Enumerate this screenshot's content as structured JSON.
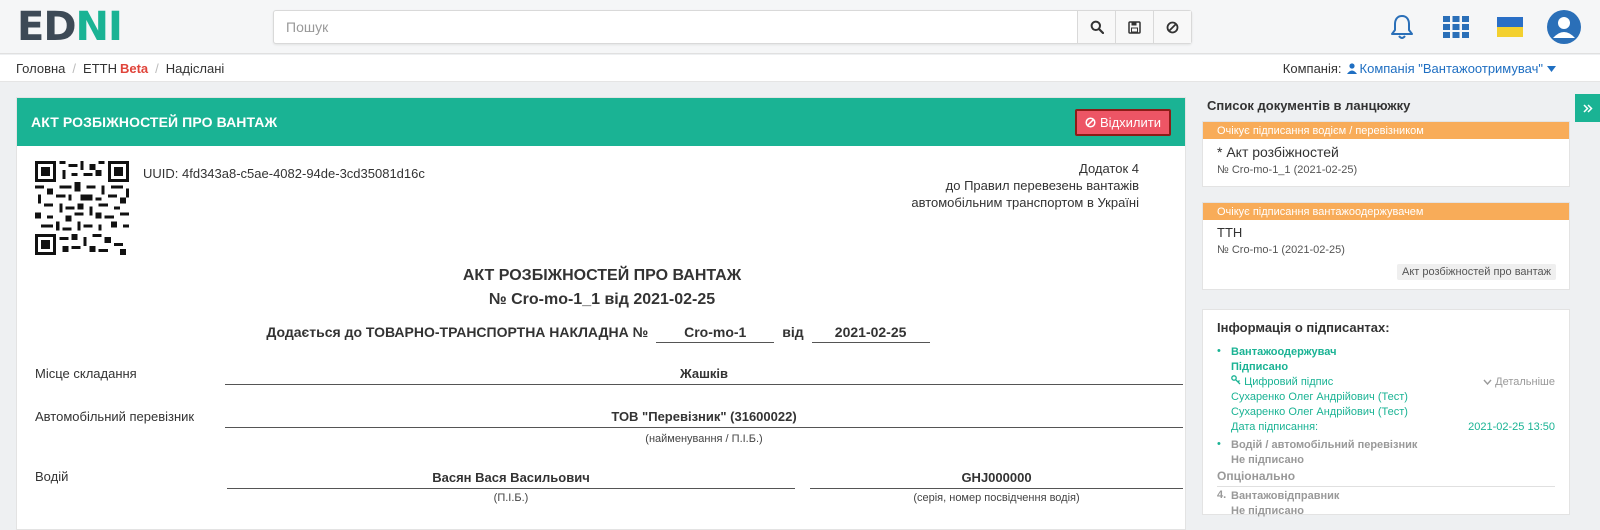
{
  "header": {
    "logo_left": "ED",
    "logo_right": "NI",
    "search_placeholder": "Пошук"
  },
  "breadcrumb": {
    "items": [
      "Головна",
      "ЕТТН",
      "Надіслані"
    ],
    "beta": "Beta"
  },
  "company": {
    "label": "Компанія:",
    "value": "Компанія \"Вантажоотримувач\""
  },
  "doc": {
    "header_title": "АКТ РОЗБІЖНОСТЕЙ ПРО ВАНТАЖ",
    "reject_label": "Відхилити",
    "uuid": "UUID: 4fd343a8-c5ae-4082-94de-3cd35081d16c",
    "appendix": [
      "Додаток 4",
      "до Правил перевезень вантажів",
      "автомобільним транспортом в Україні"
    ],
    "title": "АКТ РОЗБІЖНОСТЕЙ ПРО ВАНТАЖ",
    "number_line": "№ Cro-mo-1_1 від 2021-02-25",
    "attach_prefix": "Додається до ТОВАРНО-ТРАНСПОРТНА НАКЛАДНА №",
    "attach_number": "Cro-mo-1",
    "attach_from": "від",
    "attach_date": "2021-02-25",
    "rows": {
      "place_label": "Місце складання",
      "place_value": "Жашків",
      "carrier_label": "Автомобільний перевізник",
      "carrier_value": "ТОВ \"Перевізник\" (31600022)",
      "carrier_hint": "(найменування / П.І.Б.)",
      "driver_label": "Водій",
      "driver_value": "Васян Вася Васильович",
      "driver_hint": "(П.І.Б.)",
      "license_value": "GHJ000000",
      "license_hint": "(серія, номер посвідчення водія)"
    }
  },
  "side": {
    "title": "Список документів в ланцюжку",
    "card1": {
      "badge": "Очікує підписання водієм / перевізником",
      "name": "* Акт розбіжностей",
      "number": "№ Cro-mo-1_1 (2021-02-25)"
    },
    "card2": {
      "badge": "Очікує підписання вантажоодержувачем",
      "name": "ТТН",
      "number": "№ Cro-mo-1 (2021-02-25)",
      "tag": "Акт розбіжностей про вантаж"
    },
    "signers": {
      "title": "Інформація о підписантах:",
      "s1_role": "Вантажоодержувач",
      "s1_status": "Підписано",
      "s1_type": "Цифровий підпис",
      "s1_details": "Детальніше",
      "s1_name1": "Сухаренко Олег Андрійович (Тест)",
      "s1_name2": "Сухаренко Олег Андрійович (Тест)",
      "s1_date_label": "Дата підписання:",
      "s1_date": "2021-02-25 13:50",
      "s2_role": "Водій / автомобільний перевізник",
      "s2_status": "Не підписано",
      "optional": "Опціонально",
      "s3_num": "4.",
      "s3_role": "Вантажовідправник",
      "s3_status": "Не підписано"
    }
  },
  "colors": {
    "accent": "#1ab394",
    "danger": "#ed5565",
    "warning": "#f8ac59",
    "link": "#1f6fc2"
  }
}
